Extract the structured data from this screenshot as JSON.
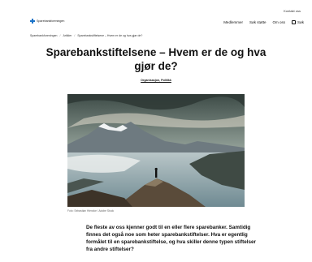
{
  "header": {
    "contact": "Kontakt oss",
    "logo_text": "Sparebankforeningen",
    "nav": [
      "Medlemmer",
      "Søk støtte",
      "Om oss"
    ],
    "search_label": "Søk"
  },
  "breadcrumb": [
    "Sparebankforeningen",
    "Artikler",
    "Sparebankstiftelsene – Hvem er de og hva gjør de?"
  ],
  "article": {
    "title": "Sparebankstiftelsene – Hvem er de og hva gjør de?",
    "tags": "Organisasjon, Politikk",
    "image_caption": "Foto: Sebastian Hienzke / Adobe Stock",
    "lead": "De fleste av oss kjenner godt til en eller flere sparebanker. Samtidig finnes det også noe som heter sparebankstiftelser. Hva er egentlig formålet til en sparebankstiftelse, og hva skiller denne typen stiftelser fra andre stiftelser?"
  },
  "icons": {
    "logo": "logo-icon",
    "search": "search-icon"
  },
  "colors": {
    "brand": "#1a73c8"
  }
}
